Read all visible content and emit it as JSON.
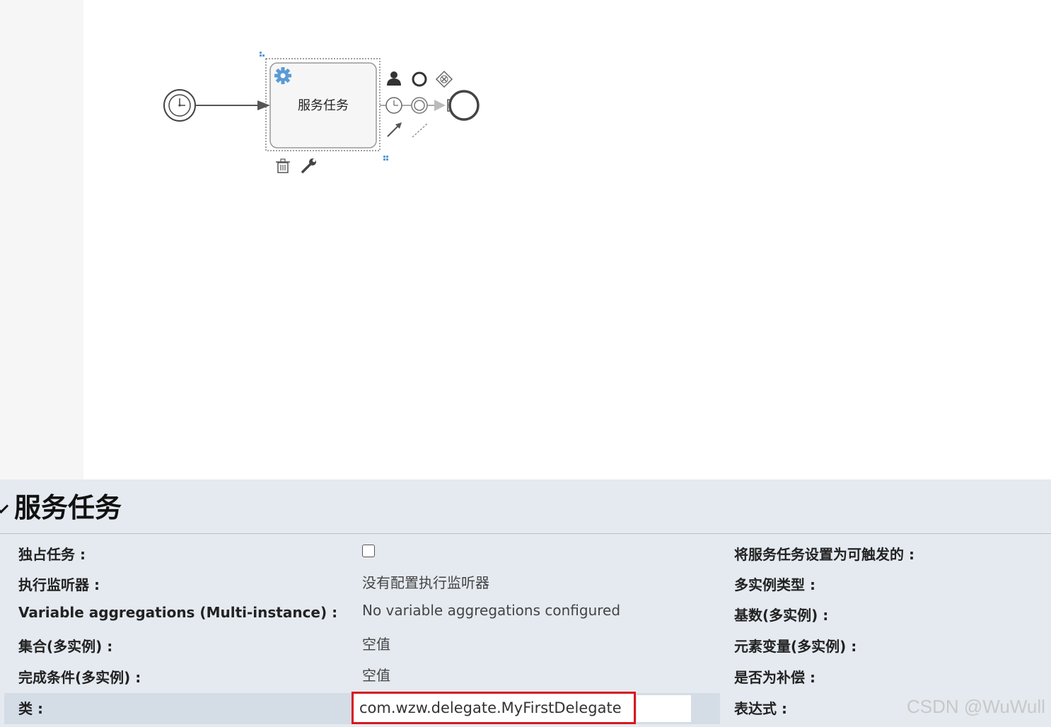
{
  "diagram": {
    "task_name": "服务任务"
  },
  "properties": {
    "title": "服务任务",
    "rows": [
      {
        "label": "独占任务 :",
        "value": ""
      },
      {
        "label": "执行监听器 :",
        "value": "没有配置执行监听器"
      },
      {
        "label": "Variable aggregations (Multi-instance) :",
        "value": "No variable aggregations configured"
      },
      {
        "label": "集合(多实例) :",
        "value": "空值"
      },
      {
        "label": "完成条件(多实例) :",
        "value": "空值"
      },
      {
        "label": "类 :",
        "value": "com.wzw.delegate.MyFirstDelegate"
      }
    ],
    "right_rows": [
      {
        "label": "将服务任务设置为可触发的 :"
      },
      {
        "label": "多实例类型 :"
      },
      {
        "label": "基数(多实例) :"
      },
      {
        "label": "元素变量(多实例) :"
      },
      {
        "label": "是否为补偿 :"
      },
      {
        "label": "表达式 :"
      }
    ],
    "exclusive_checked": false
  },
  "colors": {
    "highlight_border": "#d9161f",
    "gear": "#5b9bd5",
    "panel_bg": "#e5eaf0"
  },
  "watermark": "CSDN @WuWull"
}
